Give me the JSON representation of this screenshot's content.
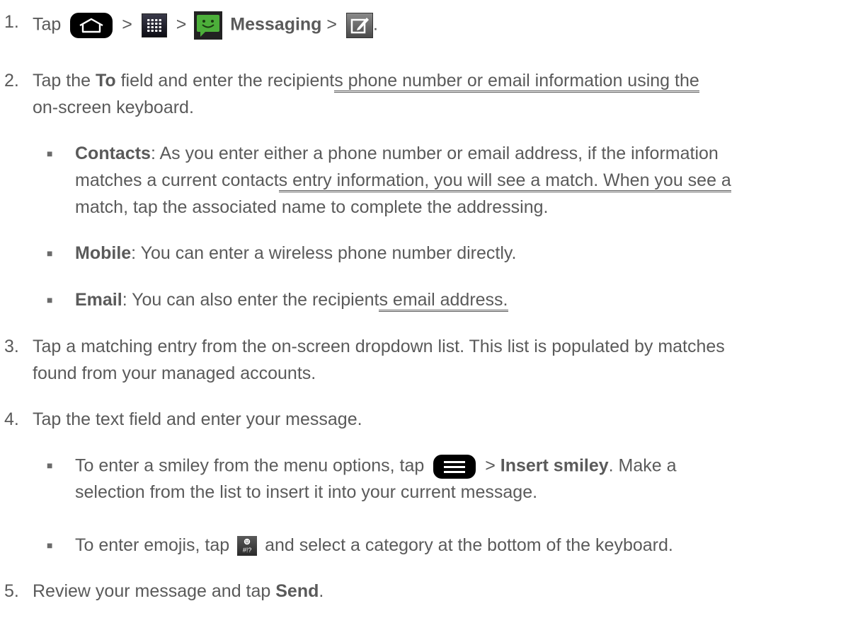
{
  "steps": [
    {
      "num": "1.",
      "tap": "Tap",
      "gt": ">",
      "messaging": "Messaging",
      "end": "."
    },
    {
      "num": "2.",
      "l1a": "Tap the",
      "to": "To",
      "l1b": "field and enter the recipient",
      "l1c": "s phone number or email information using the",
      "l2": "on-screen keyboard."
    },
    {
      "num": "3.",
      "l1": "Tap a matching entry from the on-screen dropdown list. This list is populated by matches",
      "l2": "found from your managed accounts."
    },
    {
      "num": "4.",
      "l1": "Tap the text field and enter your message."
    },
    {
      "num": "5.",
      "l1a": "Review your message and tap",
      "send": "Send",
      "end": "."
    }
  ],
  "bullets": {
    "marker": "■",
    "contacts": {
      "label": "Contacts",
      "l1": ": As you enter either a phone number or email address, if the information",
      "l2a": "matches a current contact",
      "l2b": "s entry information, you will see a match. When you see a",
      "l3": "match, tap the associated name to complete the addressing."
    },
    "mobile": {
      "label": "Mobile",
      "text": ": You can enter a wireless phone number directly."
    },
    "email": {
      "label": "Email",
      "text_a": ": You can also enter the recipient",
      "text_b": "s email address."
    },
    "smiley": {
      "l1a": "To enter a smiley from the menu options, tap",
      "gt": ">",
      "insert": "Insert smiley",
      "l1b": ". Make a",
      "l2": "selection from the list to insert it into your current message."
    },
    "emoji": {
      "l1a": "To enter emojis, tap",
      "key_label": "#!?",
      "l1b": "and select a category at the bottom of the keyboard."
    }
  },
  "icons": {
    "home": "home-icon",
    "apps": "apps-grid-icon",
    "messaging": "messaging-app-icon",
    "compose": "compose-icon",
    "menu": "menu-icon",
    "emoji": "emoji-key-icon"
  }
}
